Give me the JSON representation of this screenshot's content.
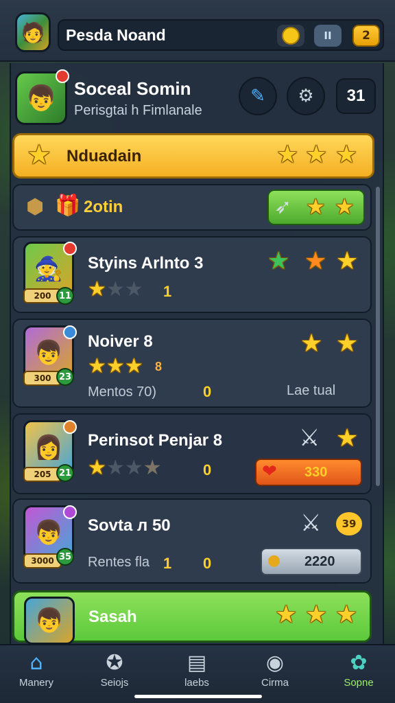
{
  "header": {
    "title": "Pesda Noand",
    "pause_label": "II",
    "badge_label": "2"
  },
  "player": {
    "name": "Socеal Somin",
    "subtitle": "Perisgtai h Fimlanale",
    "count": "31"
  },
  "banner": {
    "label": "Nduadain"
  },
  "summary": {
    "label": "2otin"
  },
  "levels": [
    {
      "title": "Styins Arlnto 3",
      "level": "200",
      "badge": "11",
      "rating": 1,
      "number": "1"
    },
    {
      "title": "Noiver 8",
      "level": "300",
      "badge": "23",
      "rating": 3,
      "number": "8",
      "note": "Mentos 70)",
      "zero": "0",
      "right": "Lae tual"
    },
    {
      "title": "Perinsot Penjar 8",
      "level": "205",
      "badge": "21",
      "rating": 1,
      "zero": "0",
      "health": "330"
    },
    {
      "title": "Sovta л 50",
      "level": "3000",
      "badge": "35",
      "note": "Rentes fla",
      "number": "1",
      "zero": "0",
      "score": "2220",
      "hex": "39"
    },
    {
      "title": "Sasah"
    }
  ],
  "nav": [
    {
      "label": "Manery",
      "icon": "home-icon"
    },
    {
      "label": "Seiojs",
      "icon": "star-icon"
    },
    {
      "label": "laebs",
      "icon": "calendar-icon"
    },
    {
      "label": "Cirma",
      "icon": "chat-icon"
    },
    {
      "label": "Sopne",
      "icon": "pet-icon"
    }
  ],
  "colors": {
    "accent": "#f5b023",
    "green": "#5cc93b",
    "panel": "#2f3c4e"
  }
}
